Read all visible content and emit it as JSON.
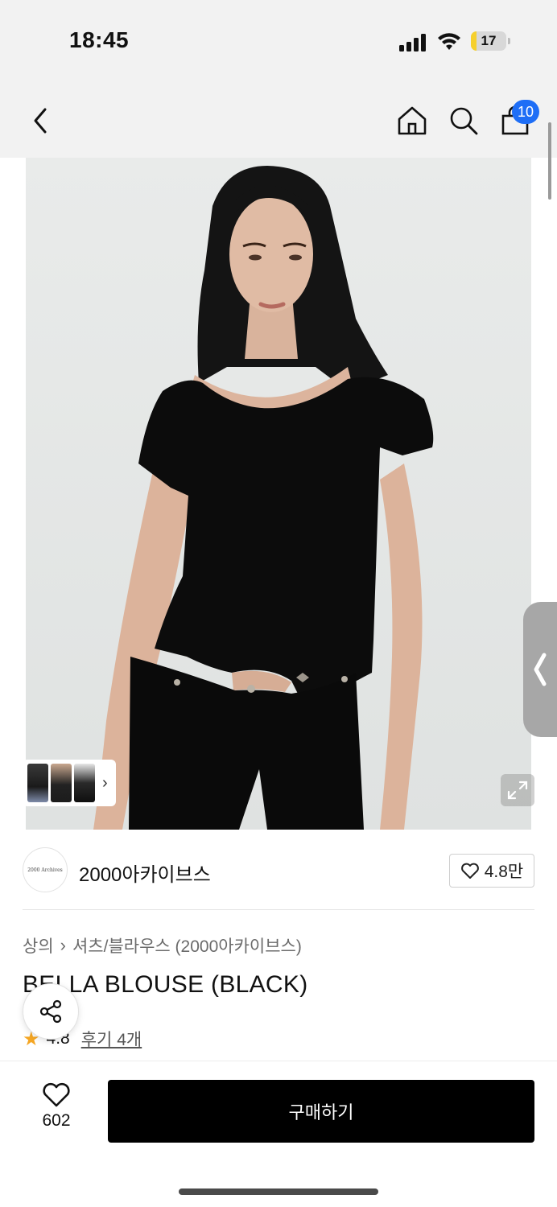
{
  "status": {
    "time": "18:45",
    "battery": "17",
    "battery_level": 0.17
  },
  "header": {
    "cart_count": "10",
    "icons": [
      "back-icon",
      "home-icon",
      "search-icon",
      "shopping-bag-icon"
    ]
  },
  "gallery": {
    "thumb_count": 3
  },
  "brand": {
    "logo_text": "2000 Archives",
    "name": "2000아카이브스",
    "likes": "4.8만"
  },
  "product": {
    "breadcrumb": [
      "상의",
      "셔츠/블라우스 (2000아카이브스)"
    ],
    "title": "BELLA BLOUSE (BLACK)",
    "rating": "4.8",
    "review_label": "후기 4개"
  },
  "bottom": {
    "wish_count": "602",
    "buy_label": "구매하기"
  },
  "colors": {
    "accent": "#1e6ef6",
    "buy_button": "#000000",
    "star": "#f5a623"
  }
}
